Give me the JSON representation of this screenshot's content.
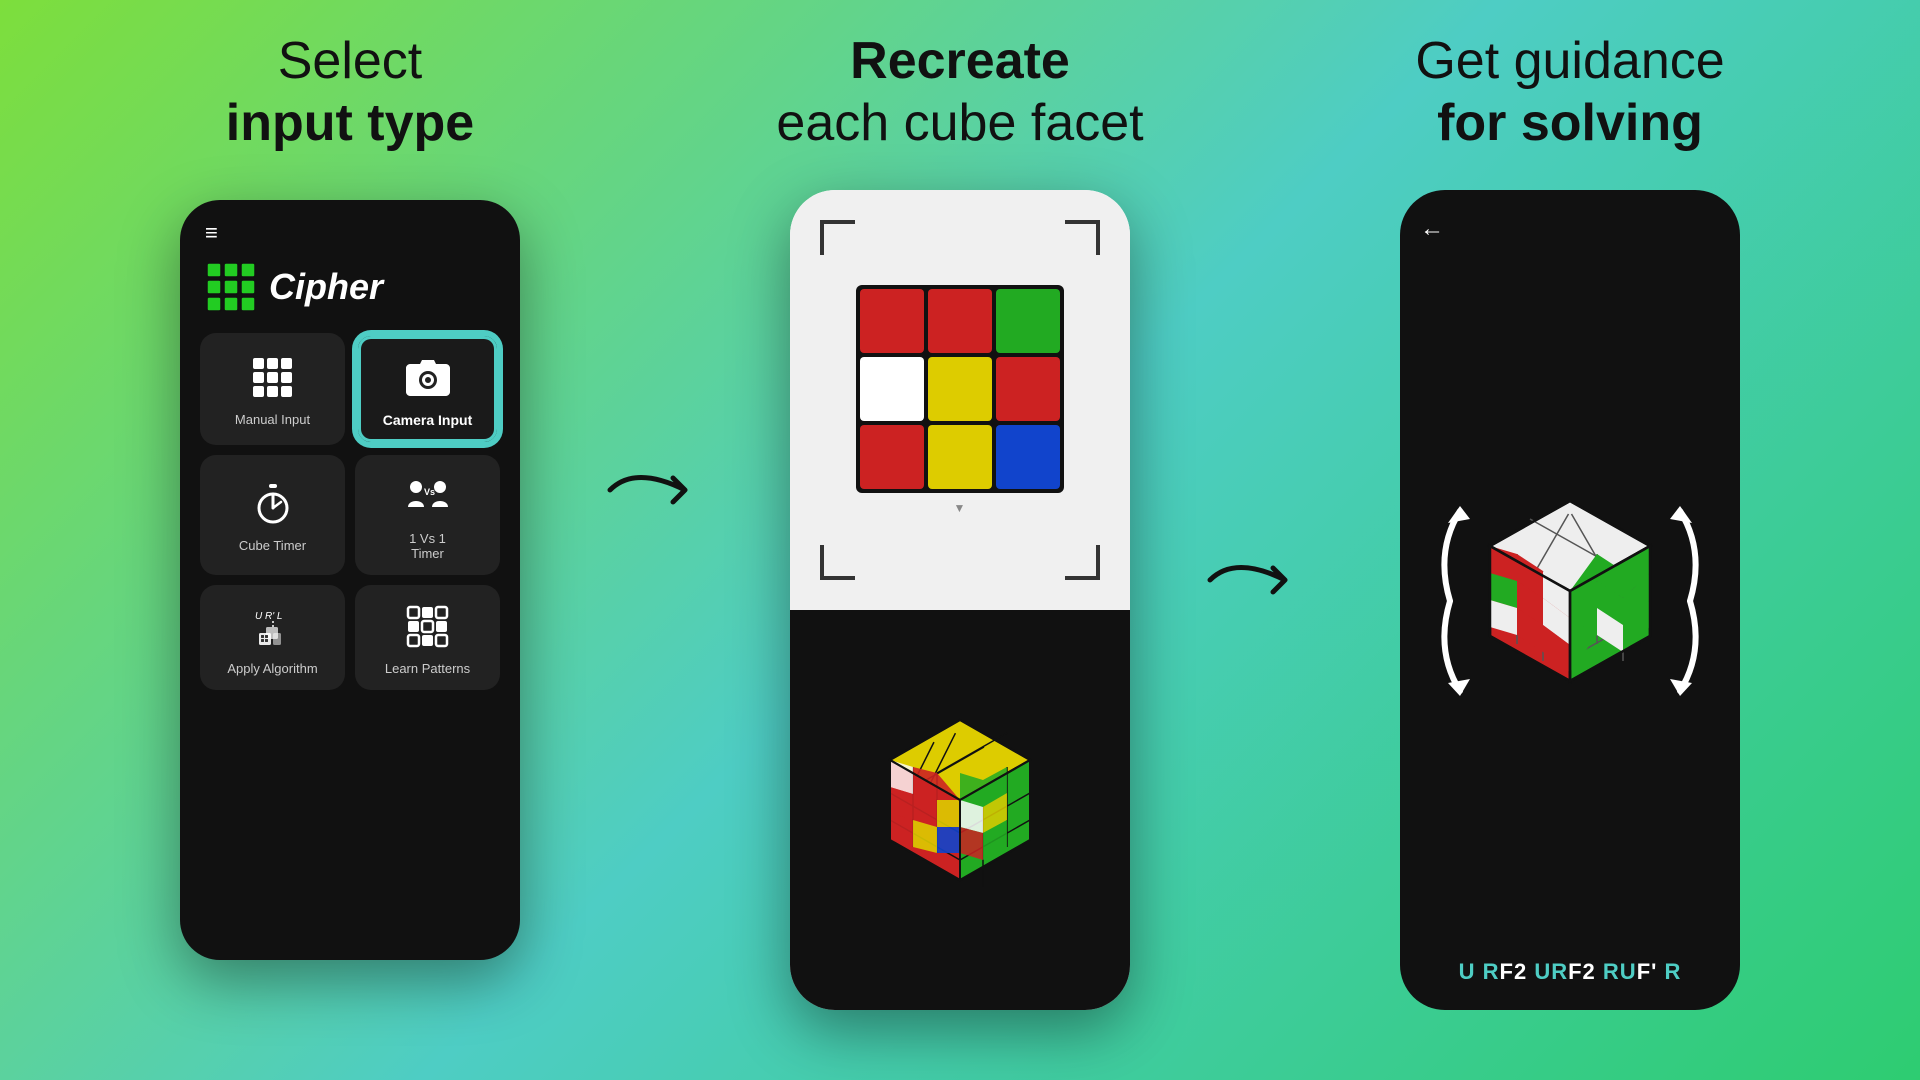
{
  "background": {
    "gradient_start": "#7dde3c",
    "gradient_end": "#4ecdc4"
  },
  "section1": {
    "title_line1": "Select",
    "title_line2_bold": "input type",
    "app_name": "Cipher",
    "menu_items": [
      {
        "id": "manual-input",
        "label": "Manual Input",
        "icon": "grid-icon"
      },
      {
        "id": "camera-input",
        "label": "Camera Input",
        "icon": "camera-icon",
        "active": true
      },
      {
        "id": "cube-timer",
        "label": "Cube Timer",
        "icon": "timer-icon"
      },
      {
        "id": "1v1-timer",
        "label": "1 Vs 1\nTimer",
        "icon": "versus-icon"
      },
      {
        "id": "apply-algorithm",
        "label": "Apply Algorithm",
        "icon": "algo-icon"
      },
      {
        "id": "learn-patterns",
        "label": "Learn Patterns",
        "icon": "pattern-icon"
      }
    ]
  },
  "section2": {
    "title_line1": "Recreate",
    "title_line2": "each cube facet"
  },
  "section3": {
    "title_line1": "Get guidance",
    "title_line2_bold": "for solving",
    "algorithm": "URF2URF2RUF'R",
    "algorithm_colored": [
      {
        "text": "U",
        "color": "green"
      },
      {
        "text": "R",
        "color": "green"
      },
      {
        "text": "F2",
        "color": "white"
      },
      {
        "text": "U",
        "color": "green"
      },
      {
        "text": "R",
        "color": "green"
      },
      {
        "text": "F2",
        "color": "white"
      },
      {
        "text": "R",
        "color": "green"
      },
      {
        "text": "U",
        "color": "green"
      },
      {
        "text": "F'",
        "color": "white"
      },
      {
        "text": "R",
        "color": "green"
      }
    ]
  },
  "cube_colors_top_face": [
    "#e0e0e0",
    "#e0e0e0",
    "#e0e0e0",
    "#e0e0e0",
    "#e0e0e0",
    "#e0e0e0",
    "#e0e0e0",
    "#e0e0e0",
    "#e0e0e0"
  ],
  "cube_scan_colors": [
    "#cc0000",
    "#cc0000",
    "#22aa22",
    "#ffffff",
    "#ddaa00",
    "#cc0000",
    "#cc0000",
    "#ddaa00",
    "#1155cc"
  ],
  "cube_3d_colors": [
    "#cc0000",
    "#22aa22",
    "#ffffff",
    "#ddaa00",
    "#cc0000",
    "#1155cc"
  ],
  "labels": {
    "hamburger": "≡",
    "back_arrow": "←"
  }
}
